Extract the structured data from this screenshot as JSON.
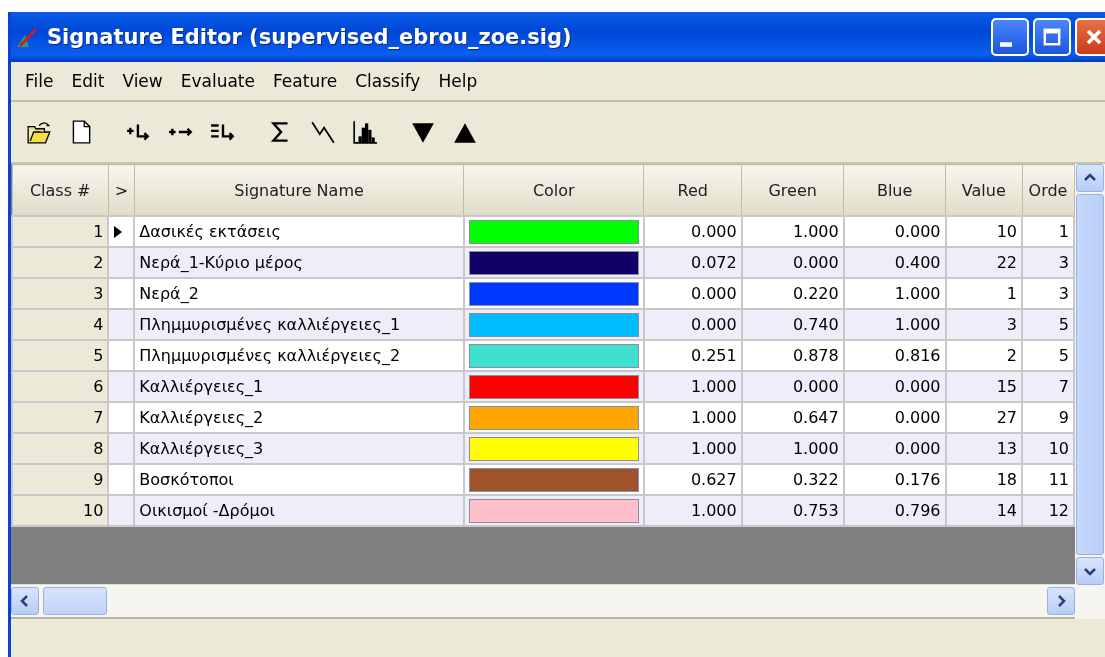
{
  "window": {
    "title": "Signature Editor (supervised_ebrou_zoe.sig)"
  },
  "menu": [
    "File",
    "Edit",
    "View",
    "Evaluate",
    "Feature",
    "Classify",
    "Help"
  ],
  "toolbar": [
    {
      "kind": "open"
    },
    {
      "kind": "new"
    },
    {
      "kind": "add"
    },
    {
      "kind": "replace"
    },
    {
      "kind": "merge"
    },
    {
      "kind": "stats"
    },
    {
      "kind": "mean"
    },
    {
      "kind": "histogram"
    },
    {
      "kind": "down"
    },
    {
      "kind": "up"
    }
  ],
  "table": {
    "columns": [
      "Class #",
      ">",
      "Signature Name",
      "Color",
      "Red",
      "Green",
      "Blue",
      "Value",
      "Orde"
    ],
    "rows": [
      {
        "class": "1",
        "current": true,
        "name": "Δασικές εκτάσεις",
        "color": "#00ff00",
        "red": "0.000",
        "green": "1.000",
        "blue": "0.000",
        "value": "10",
        "order": "1"
      },
      {
        "class": "2",
        "current": false,
        "name": "Νερά_1-Κύριο μέρος",
        "color": "#120066",
        "red": "0.072",
        "green": "0.000",
        "blue": "0.400",
        "value": "22",
        "order": "3"
      },
      {
        "class": "3",
        "current": false,
        "name": "Νερά_2",
        "color": "#0038ff",
        "red": "0.000",
        "green": "0.220",
        "blue": "1.000",
        "value": "1",
        "order": "3"
      },
      {
        "class": "4",
        "current": false,
        "name": "Πλημμυρισμένες καλλιέργειες_1",
        "color": "#00bdff",
        "red": "0.000",
        "green": "0.740",
        "blue": "1.000",
        "value": "3",
        "order": "5"
      },
      {
        "class": "5",
        "current": false,
        "name": "Πλημμυρισμένες καλλιέργειες_2",
        "color": "#40e0d0",
        "red": "0.251",
        "green": "0.878",
        "blue": "0.816",
        "value": "2",
        "order": "5"
      },
      {
        "class": "6",
        "current": false,
        "name": "Καλλιέργειες_1",
        "color": "#ff0000",
        "red": "1.000",
        "green": "0.000",
        "blue": "0.000",
        "value": "15",
        "order": "7"
      },
      {
        "class": "7",
        "current": false,
        "name": "Καλλιέργειες_2",
        "color": "#ffa500",
        "red": "1.000",
        "green": "0.647",
        "blue": "0.000",
        "value": "27",
        "order": "9"
      },
      {
        "class": "8",
        "current": false,
        "name": "Καλλιέργειες_3",
        "color": "#ffff00",
        "red": "1.000",
        "green": "1.000",
        "blue": "0.000",
        "value": "13",
        "order": "10"
      },
      {
        "class": "9",
        "current": false,
        "name": "Βοσκότοποι",
        "color": "#a0522d",
        "red": "0.627",
        "green": "0.322",
        "blue": "0.176",
        "value": "18",
        "order": "11"
      },
      {
        "class": "10",
        "current": false,
        "name": "Οικισμοί -Δρόμοι",
        "color": "#ffc0cb",
        "red": "1.000",
        "green": "0.753",
        "blue": "0.796",
        "value": "14",
        "order": "12"
      }
    ]
  }
}
